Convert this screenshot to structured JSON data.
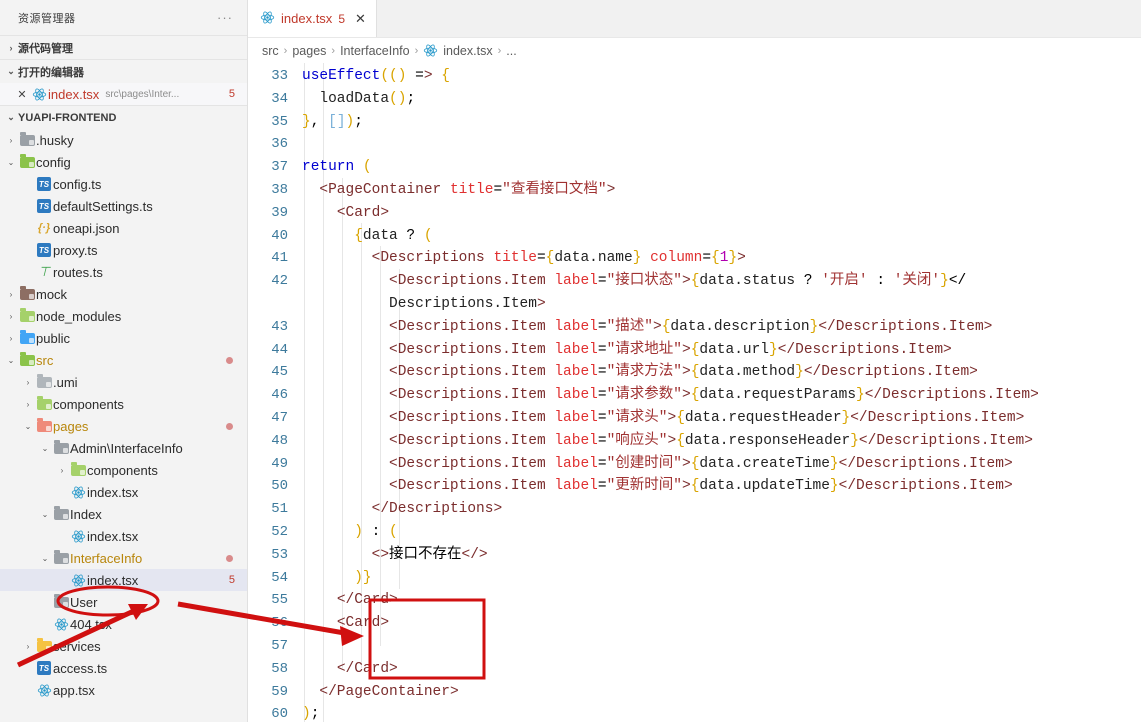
{
  "sidebar": {
    "title": "资源管理器",
    "ellipsis": "···",
    "sections": [
      {
        "name": "源代码管理",
        "twisty": "›"
      },
      {
        "name": "打开的编辑器",
        "twisty": "⌄"
      }
    ],
    "open_editor": {
      "close": "✕",
      "icon": "react-icon",
      "name": "index.tsx",
      "path": "src\\pages\\Inter...",
      "badge": "5"
    },
    "project": {
      "name": "YUAPI-FRONTEND",
      "twisty": "⌄"
    },
    "tree": [
      {
        "label": ".husky",
        "depth": 1,
        "twisty": "›",
        "icon": "folder-gray",
        "badge": "",
        "dot": false,
        "selected": false
      },
      {
        "label": "config",
        "depth": 1,
        "twisty": "⌄",
        "icon": "folder-green",
        "badge": "",
        "dot": false,
        "selected": false
      },
      {
        "label": "config.ts",
        "depth": 2,
        "twisty": "",
        "icon": "ts-file",
        "badge": "",
        "dot": false,
        "selected": false
      },
      {
        "label": "defaultSettings.ts",
        "depth": 2,
        "twisty": "",
        "icon": "ts-file",
        "badge": "",
        "dot": false,
        "selected": false
      },
      {
        "label": "oneapi.json",
        "depth": 2,
        "twisty": "",
        "icon": "json-file",
        "badge": "",
        "dot": false,
        "selected": false
      },
      {
        "label": "proxy.ts",
        "depth": 2,
        "twisty": "",
        "icon": "ts-file",
        "badge": "",
        "dot": false,
        "selected": false
      },
      {
        "label": "routes.ts",
        "depth": 2,
        "twisty": "",
        "icon": "routes-file",
        "badge": "",
        "dot": false,
        "selected": false
      },
      {
        "label": "mock",
        "depth": 1,
        "twisty": "›",
        "icon": "folder-brown",
        "badge": "",
        "dot": false,
        "selected": false
      },
      {
        "label": "node_modules",
        "depth": 1,
        "twisty": "›",
        "icon": "folder-lgreen",
        "badge": "",
        "dot": false,
        "selected": false
      },
      {
        "label": "public",
        "depth": 1,
        "twisty": "›",
        "icon": "folder-blue",
        "badge": "",
        "dot": false,
        "selected": false
      },
      {
        "label": "src",
        "depth": 1,
        "twisty": "⌄",
        "icon": "folder-green",
        "badge": "",
        "dot": true,
        "selected": false,
        "modified": true
      },
      {
        "label": ".umi",
        "depth": 2,
        "twisty": "›",
        "icon": "folder-dgray",
        "badge": "",
        "dot": false,
        "selected": false
      },
      {
        "label": "components",
        "depth": 2,
        "twisty": "›",
        "icon": "folder-lgreen",
        "badge": "",
        "dot": false,
        "selected": false
      },
      {
        "label": "pages",
        "depth": 2,
        "twisty": "⌄",
        "icon": "folder-red",
        "badge": "",
        "dot": true,
        "selected": false,
        "modified": true
      },
      {
        "label": "Admin\\InterfaceInfo",
        "depth": 3,
        "twisty": "⌄",
        "icon": "folder-gray",
        "badge": "",
        "dot": false,
        "selected": false
      },
      {
        "label": "components",
        "depth": 4,
        "twisty": "›",
        "icon": "folder-lgreen",
        "badge": "",
        "dot": false,
        "selected": false
      },
      {
        "label": "index.tsx",
        "depth": 4,
        "twisty": "",
        "icon": "react-file",
        "badge": "",
        "dot": false,
        "selected": false
      },
      {
        "label": "Index",
        "depth": 3,
        "twisty": "⌄",
        "icon": "folder-gray",
        "badge": "",
        "dot": false,
        "selected": false
      },
      {
        "label": "index.tsx",
        "depth": 4,
        "twisty": "",
        "icon": "react-file",
        "badge": "",
        "dot": false,
        "selected": false
      },
      {
        "label": "InterfaceInfo",
        "depth": 3,
        "twisty": "⌄",
        "icon": "folder-gray",
        "badge": "",
        "dot": true,
        "selected": false,
        "modified": true
      },
      {
        "label": "index.tsx",
        "depth": 4,
        "twisty": "",
        "icon": "react-file",
        "badge": "5",
        "dot": false,
        "selected": true
      },
      {
        "label": "User",
        "depth": 3,
        "twisty": "",
        "icon": "folder-gray",
        "badge": "",
        "dot": false,
        "selected": false
      },
      {
        "label": "404.tsx",
        "depth": 3,
        "twisty": "",
        "icon": "react-file",
        "badge": "",
        "dot": false,
        "selected": false
      },
      {
        "label": "services",
        "depth": 2,
        "twisty": "›",
        "icon": "folder-yellow",
        "badge": "",
        "dot": false,
        "selected": false
      },
      {
        "label": "access.ts",
        "depth": 2,
        "twisty": "",
        "icon": "ts-file",
        "badge": "",
        "dot": false,
        "selected": false
      },
      {
        "label": "app.tsx",
        "depth": 2,
        "twisty": "",
        "icon": "react-file",
        "badge": "",
        "dot": false,
        "selected": false
      }
    ]
  },
  "tab": {
    "icon": "react-icon",
    "name": "index.tsx",
    "count": "5",
    "close": "✕"
  },
  "breadcrumb": {
    "items": [
      "src",
      "pages",
      "InterfaceInfo",
      "index.tsx",
      "..."
    ],
    "separator": "›",
    "file_icon": "react-icon"
  },
  "editor": {
    "first_line_number": 33,
    "line_numbers": [
      33,
      34,
      35,
      36,
      37,
      38,
      39,
      40,
      41,
      42,
      "",
      43,
      44,
      45,
      46,
      47,
      48,
      49,
      50,
      51,
      52,
      53,
      54,
      55,
      56,
      57,
      58,
      59,
      60
    ],
    "lines": [
      "useEffect(() => {",
      "  loadData();",
      "}, []);",
      "",
      "return (",
      "  <PageContainer title=\"查看接口文档\">",
      "    <Card>",
      "      {data ? (",
      "        <Descriptions title={data.name} column={1}>",
      "          <Descriptions.Item label=\"接口状态\">{data.status ? '开启' : '关闭'}</",
      "          Descriptions.Item>",
      "          <Descriptions.Item label=\"描述\">{data.description}</Descriptions.Item>",
      "          <Descriptions.Item label=\"请求地址\">{data.url}</Descriptions.Item>",
      "          <Descriptions.Item label=\"请求方法\">{data.method}</Descriptions.Item>",
      "          <Descriptions.Item label=\"请求参数\">{data.requestParams}</Descriptions.Item>",
      "          <Descriptions.Item label=\"请求头\">{data.requestHeader}</Descriptions.Item>",
      "          <Descriptions.Item label=\"响应头\">{data.responseHeader}</Descriptions.Item>",
      "          <Descriptions.Item label=\"创建时间\">{data.createTime}</Descriptions.Item>",
      "          <Descriptions.Item label=\"更新时间\">{data.updateTime}</Descriptions.Item>",
      "        </Descriptions>",
      "      ) : (",
      "        <>接口不存在</>",
      "      )}",
      "    </Card>",
      "    <Card>",
      "",
      "    </Card>",
      "  </PageContainer>",
      ");"
    ]
  },
  "annotations": {
    "ellipse_target": "index.tsx",
    "rect_target": "<Card> ... </Card>",
    "color": "#d01010"
  }
}
